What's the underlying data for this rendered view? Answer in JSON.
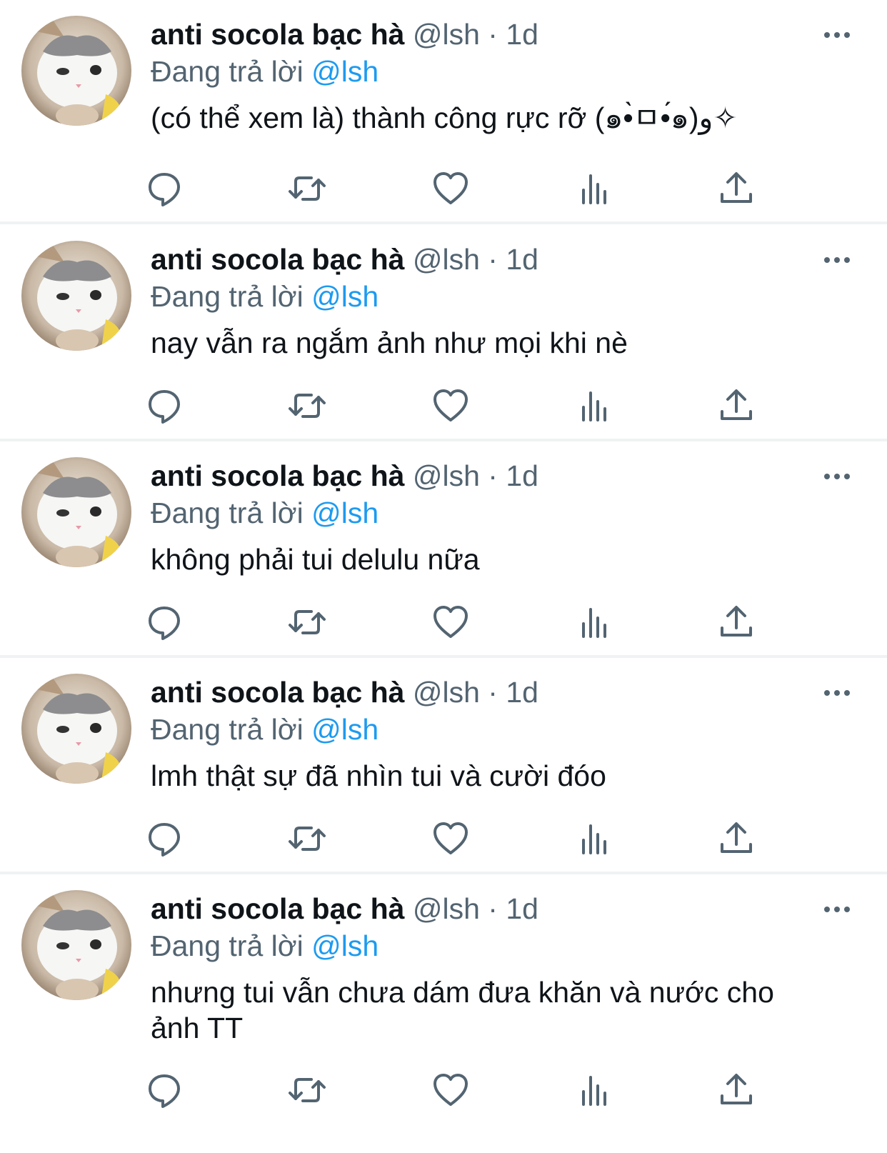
{
  "tweets": [
    {
      "display_name": "anti socola bạc hà",
      "handle": "@lsh",
      "sep": " · ",
      "time": "1d",
      "reply_prefix": "Đang trả lời ",
      "reply_to": "@lsh",
      "text": "(có thể xem là) thành công rực rỡ (๑•̀ㅁ•́๑)و✧"
    },
    {
      "display_name": "anti socola bạc hà",
      "handle": "@lsh",
      "sep": " · ",
      "time": "1d",
      "reply_prefix": "Đang trả lời ",
      "reply_to": "@lsh",
      "text": "nay vẫn ra ngắm ảnh như mọi khi nè"
    },
    {
      "display_name": "anti socola bạc hà",
      "handle": "@lsh",
      "sep": " · ",
      "time": "1d",
      "reply_prefix": "Đang trả lời ",
      "reply_to": "@lsh",
      "text": "không phải tui delulu nữa"
    },
    {
      "display_name": "anti socola bạc hà",
      "handle": "@lsh",
      "sep": " · ",
      "time": "1d",
      "reply_prefix": "Đang trả lời ",
      "reply_to": "@lsh",
      "text": "lmh thật sự đã nhìn tui và cười đóo"
    },
    {
      "display_name": "anti socola bạc hà",
      "handle": "@lsh",
      "sep": " · ",
      "time": "1d",
      "reply_prefix": "Đang trả lời ",
      "reply_to": "@lsh",
      "text": "nhưng tui vẫn chưa dám đưa khăn và nước cho ảnh TT"
    }
  ],
  "icons": {
    "more": "more-horizontal-icon",
    "reply": "reply-bubble-icon",
    "retweet": "retweet-icon",
    "like": "heart-icon",
    "views": "views-bar-chart-icon",
    "share": "share-upload-icon"
  },
  "colors": {
    "name": "#0f1419",
    "meta": "#536471",
    "mention": "#1d9bf0",
    "divider": "#eff3f4"
  }
}
